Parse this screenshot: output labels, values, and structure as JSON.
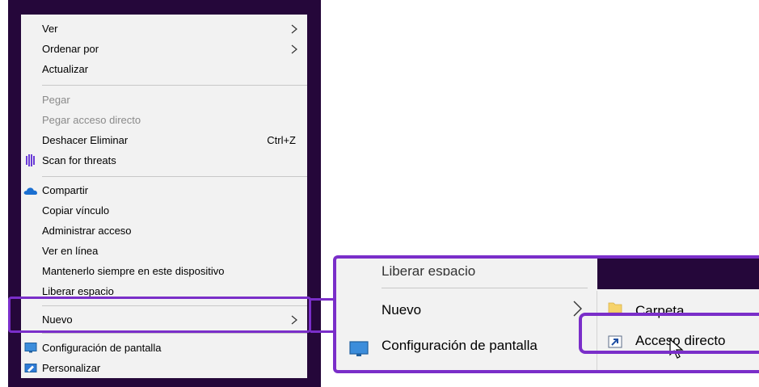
{
  "context_menu": {
    "items": [
      {
        "label": "Ver",
        "submenu": true
      },
      {
        "label": "Ordenar por",
        "submenu": true
      },
      {
        "label": "Actualizar"
      },
      {
        "label": "Pegar",
        "disabled": true
      },
      {
        "label": "Pegar acceso directo",
        "disabled": true
      },
      {
        "label": "Deshacer Eliminar",
        "shortcut": "Ctrl+Z"
      },
      {
        "label": "Scan for threats",
        "icon": "shield-scan-icon"
      },
      {
        "label": "Compartir",
        "icon": "onedrive-cloud-icon"
      },
      {
        "label": "Copiar vínculo"
      },
      {
        "label": "Administrar acceso"
      },
      {
        "label": "Ver en línea"
      },
      {
        "label": "Mantenerlo siempre en este dispositivo"
      },
      {
        "label": "Liberar espacio"
      },
      {
        "label": "Nuevo",
        "submenu": true
      },
      {
        "label": "Configuración de pantalla",
        "icon": "display-icon"
      },
      {
        "label": "Personalizar",
        "icon": "personalize-icon"
      }
    ]
  },
  "zoom": {
    "cut_label": "Liberar espacio",
    "nuevo_label": "Nuevo",
    "config_label": "Configuración de pantalla",
    "submenu": {
      "folder_label": "Carpeta",
      "shortcut_label": "Acceso directo"
    }
  },
  "colors": {
    "accent": "#7a2ec9",
    "frame": "#25073a",
    "menu_bg": "#f2f2f2",
    "disabled_text": "#8a8a8a"
  }
}
